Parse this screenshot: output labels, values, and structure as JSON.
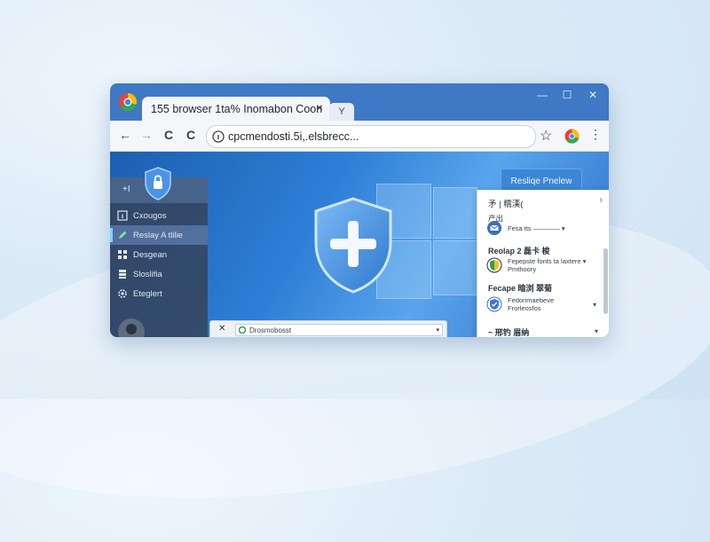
{
  "window": {
    "tab_title": "155 browser 1ta% Inomabon Coon",
    "tab_close": "×",
    "newtab_label": "Y",
    "controls": {
      "minimize": "—",
      "maximize": "☐",
      "close": "✕"
    }
  },
  "toolbar": {
    "back": "←",
    "forward": "→",
    "reload": "C",
    "reload2": "C",
    "address": "cpcmendosti.5i,.elsbrecc...",
    "star": "☆",
    "menu": "⋮"
  },
  "sidebar": {
    "header": "+I",
    "items": [
      {
        "label": "Cxougos",
        "icon": "info-square-icon"
      },
      {
        "label": "Reslay A tlilie",
        "icon": "pen-icon",
        "active": true
      },
      {
        "label": "Desgean",
        "icon": "grid-icon"
      },
      {
        "label": "Sloslifia",
        "icon": "layers-icon"
      },
      {
        "label": "Eteglert",
        "icon": "settings-icon"
      }
    ]
  },
  "main": {
    "reimage_button": "Resliqe Pnelew"
  },
  "panel": {
    "header": "矛 | 糯漢(",
    "header_chev": "›",
    "sub1": "产出",
    "sub2": "Fesa tts  ———— ▾",
    "sections": [
      {
        "title": "Reolap 2 磊卡 梭",
        "row": {
          "line1": "Fepepste fonts ta laxtere ▾",
          "line2": "Pmthoory",
          "chev": "▾"
        }
      },
      {
        "title": "Fecape 暗浏 翠菊",
        "row": {
          "line1": "Fedorimaebeve",
          "line2": "Frorleosfos",
          "chev": "▾"
        }
      },
      {
        "title": "~ 邢钓 眉纳",
        "row": {
          "line1": "",
          "line2": "",
          "chev": "▾"
        }
      }
    ]
  },
  "bottom_bar": {
    "close": "✕",
    "field_text": "Drosmobosst",
    "chev": "▾"
  },
  "colors": {
    "titlebar": "#3f78c4",
    "accent": "#3b86d6",
    "sidebar": "#34445e"
  }
}
